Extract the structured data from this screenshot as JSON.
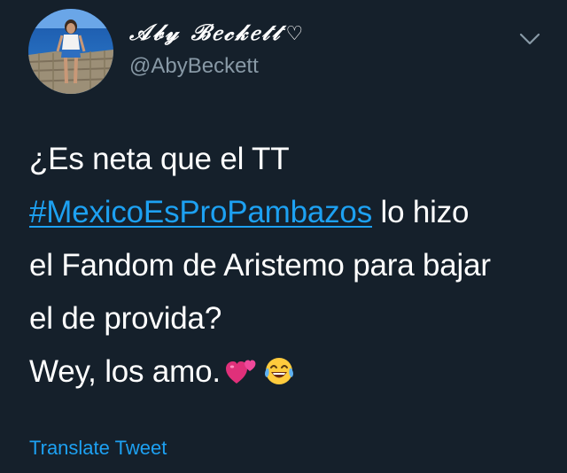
{
  "user": {
    "display_name": "𝒜𝒷𝓎 ℬ𝑒𝒸𝓀𝑒𝓉𝓉",
    "handle": "@AbyBeckett",
    "avatar_icon": "profile-photo"
  },
  "tweet": {
    "line1": "¿Es neta que el TT",
    "hashtag": "#MexicoEsProPambazos",
    "line2_rest": " lo hizo",
    "line3": "el Fandom de Aristemo para bajar",
    "line4": "el de provida?",
    "line5": "Wey, los amo.",
    "emojis": [
      "two-hearts-emoji",
      "tears-of-joy-emoji"
    ]
  },
  "actions": {
    "translate_label": "Translate Tweet",
    "menu_icon": "chevron-down-icon"
  },
  "colors": {
    "background": "#15202b",
    "text": "#ffffff",
    "secondary": "#8899a6",
    "link": "#1da1f2"
  }
}
